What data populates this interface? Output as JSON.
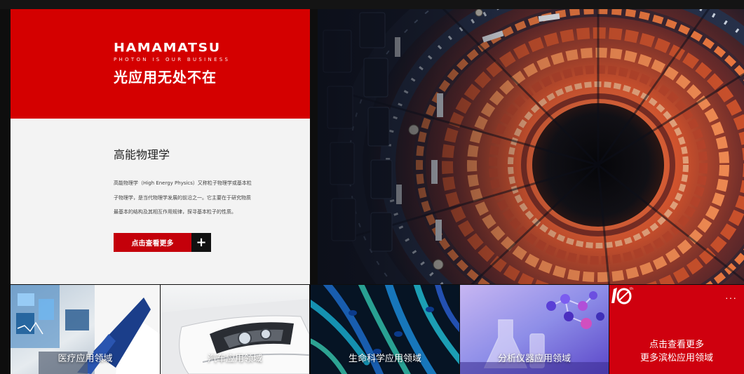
{
  "brand": {
    "logo": "HAMAMATSU",
    "tagline": "PHOTON IS OUR BUSINESS",
    "slogan": "光应用无处不在"
  },
  "feature": {
    "title": "高能物理学",
    "description_lines": [
      "高能物理学（High Energy Physics）又称粒子物理学或基本粒",
      "子物理学，是当代物理学发展的前沿之一。它主要在于研究物质",
      "最基本的结构及其相互作用规律，探寻基本粒子的性质。"
    ],
    "cta_label": "点击查看更多",
    "cta_icon": "plus-icon"
  },
  "tiles": [
    {
      "label": "医疗应用领域"
    },
    {
      "label": "汽车应用领域"
    },
    {
      "label": "生命科学应用领域"
    },
    {
      "label": "分析仪器应用领域"
    }
  ],
  "cta_tile": {
    "line1": "点击查看更多",
    "line2": "更多滨松应用领域",
    "badge_icon": "anniversary-logo-icon",
    "menu_icon": "more-dots-icon"
  },
  "colors": {
    "brand_red": "#d40000",
    "button_red": "#c4000a",
    "panel_bg": "#f3f3f3"
  }
}
